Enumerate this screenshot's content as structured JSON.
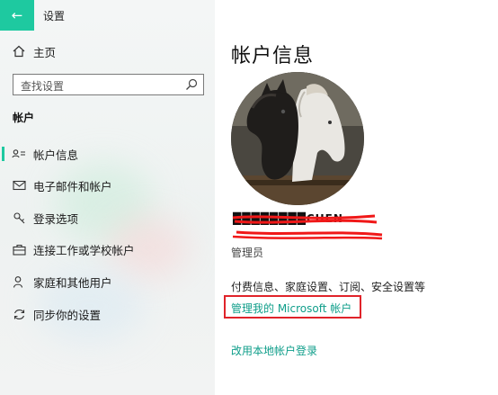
{
  "window": {
    "title": "设置",
    "back_icon": "arrow-left-icon",
    "accent_color": "#1ec9a0",
    "link_color": "#0f9e8a",
    "highlight_color": "#e0232a"
  },
  "sidebar": {
    "home": {
      "label": "主页",
      "icon": "home-icon"
    },
    "search": {
      "placeholder": "查找设置",
      "icon": "search-icon"
    },
    "section": "帐户",
    "items": [
      {
        "label": "帐户信息",
        "icon": "person-card-icon",
        "active": true
      },
      {
        "label": "电子邮件和帐户",
        "icon": "mail-icon",
        "active": false
      },
      {
        "label": "登录选项",
        "icon": "key-icon",
        "active": false
      },
      {
        "label": "连接工作或学校帐户",
        "icon": "briefcase-icon",
        "active": false
      },
      {
        "label": "家庭和其他用户",
        "icon": "person-add-icon",
        "active": false
      },
      {
        "label": "同步你的设置",
        "icon": "sync-icon",
        "active": false
      }
    ]
  },
  "main": {
    "title": "帐户信息",
    "avatar_alt": "avatar",
    "user_name": "████████CHEN",
    "role": "管理员",
    "info": "付费信息、家庭设置、订阅、安全设置等",
    "manage_link": "管理我的 Microsoft 帐户",
    "local_link": "改用本地帐户登录"
  }
}
